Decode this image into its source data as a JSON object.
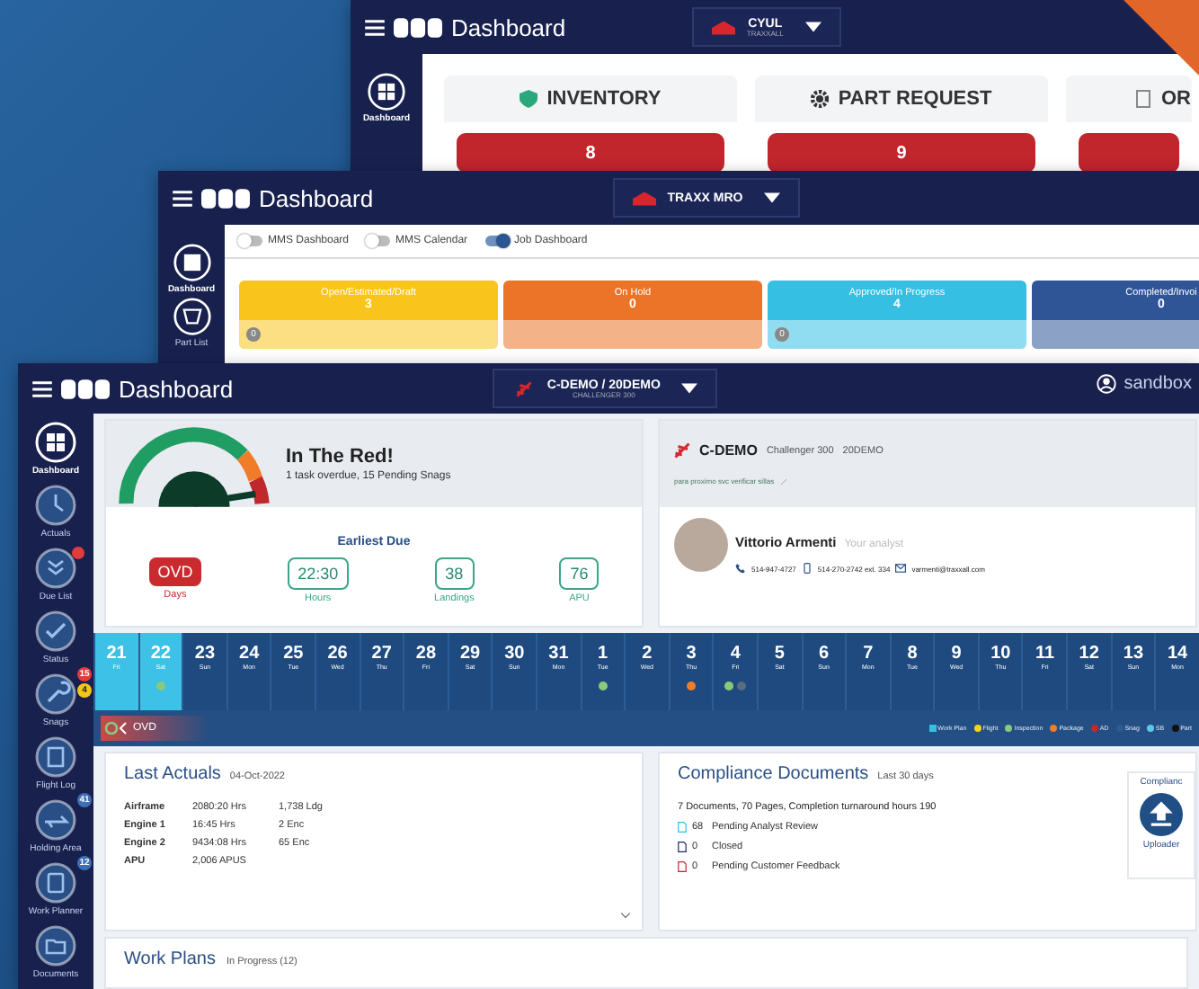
{
  "back_window": {
    "title": "Dashboard",
    "selector": {
      "name": "CYUL",
      "sub": "TRAXXALL"
    },
    "sidebar": [
      {
        "label": "Dashboard",
        "selected": true
      }
    ],
    "cards": [
      {
        "title": "INVENTORY",
        "value": "8"
      },
      {
        "title": "PART REQUEST",
        "value": "9"
      },
      {
        "title": "OR"
      }
    ]
  },
  "middle_window": {
    "title": "Dashboard",
    "selector": {
      "name": "TRAXX MRO"
    },
    "sidebar": [
      {
        "label": "Dashboard",
        "selected": true
      },
      {
        "label": "Part List",
        "selected": false
      }
    ],
    "toggles": [
      {
        "label": "MMS Dashboard",
        "on": false
      },
      {
        "label": "MMS Calendar",
        "on": false
      },
      {
        "label": "Job Dashboard",
        "on": true
      }
    ],
    "cards": [
      {
        "title": "Open/Estimated/Draft",
        "value": "3",
        "color": "#f9c51c",
        "badge": "0"
      },
      {
        "title": "On Hold",
        "value": "0",
        "color": "#ec7428"
      },
      {
        "title": "Approved/In Progress",
        "value": "4",
        "color": "#35bfe3",
        "badge": "0"
      },
      {
        "title": "Completed/Invoi",
        "value": "0",
        "color": "#2f5597"
      }
    ]
  },
  "front_window": {
    "title": "Dashboard",
    "selector": {
      "name": "C-DEMO / 20DEMO",
      "sub": "CHALLENGER 300"
    },
    "user": "sandbox",
    "sidebar": [
      {
        "label": "Dashboard",
        "selected": true
      },
      {
        "label": "Actuals",
        "selected": false
      },
      {
        "label": "Due List",
        "selected": false,
        "alert": true
      },
      {
        "label": "Status",
        "selected": false
      },
      {
        "label": "Snags",
        "selected": false,
        "badges": [
          "15",
          "4"
        ]
      },
      {
        "label": "Flight Log",
        "selected": false
      },
      {
        "label": "Holding Area",
        "selected": false,
        "badges": [
          "41"
        ]
      },
      {
        "label": "Work Planner",
        "selected": false,
        "badges": [
          "12"
        ]
      },
      {
        "label": "Documents",
        "selected": false
      }
    ],
    "status": {
      "title": "In The Red!",
      "subtitle": "1 task overdue, 15 Pending Snags",
      "due_title": "Earliest Due",
      "tiles": [
        {
          "value": "OVD",
          "label": "Days",
          "kind": "overdue"
        },
        {
          "value": "22:30",
          "label": "Hours",
          "kind": "ok"
        },
        {
          "value": "38",
          "label": "Landings",
          "kind": "ok"
        },
        {
          "value": "76",
          "label": "APU",
          "kind": "ok"
        }
      ]
    },
    "aircraft": {
      "registration": "C-DEMO",
      "model": "Challenger 300",
      "serial": "20DEMO",
      "note": "para proximo svc verificar sillas",
      "analyst": {
        "name": "Vittorio Armenti",
        "role": "Your analyst",
        "phone": "514-947-4727",
        "mobile": "514-270-2742 ext. 334",
        "email": "varmenti@traxxall.com"
      }
    },
    "calendar": {
      "days": [
        {
          "date": "21",
          "weekday": "Fri",
          "selected": true
        },
        {
          "date": "22",
          "weekday": "Sat",
          "selected": true,
          "dots": [
            {
              "color": "#8bc97a"
            }
          ]
        },
        {
          "date": "23",
          "weekday": "Sun",
          "selected": false
        },
        {
          "date": "24",
          "weekday": "Mon",
          "selected": false
        },
        {
          "date": "25",
          "weekday": "Tue",
          "selected": false
        },
        {
          "date": "26",
          "weekday": "Wed",
          "selected": false
        },
        {
          "date": "27",
          "weekday": "Thu",
          "selected": false
        },
        {
          "date": "28",
          "weekday": "Fri",
          "selected": false
        },
        {
          "date": "29",
          "weekday": "Sat",
          "selected": false
        },
        {
          "date": "30",
          "weekday": "Sun",
          "selected": false
        },
        {
          "date": "31",
          "weekday": "Mon",
          "selected": false
        },
        {
          "date": "1",
          "weekday": "Tue",
          "selected": false,
          "dots": [
            {
              "color": "#8bc97a"
            }
          ]
        },
        {
          "date": "2",
          "weekday": "Wed",
          "selected": false
        },
        {
          "date": "3",
          "weekday": "Thu",
          "selected": false,
          "dots": [
            {
              "color": "#f07b28"
            }
          ]
        },
        {
          "date": "4",
          "weekday": "Fri",
          "selected": false,
          "dots": [
            {
              "color": "#8bc97a"
            },
            {
              "color": "#5b6b80"
            }
          ]
        },
        {
          "date": "5",
          "weekday": "Sat",
          "selected": false
        },
        {
          "date": "6",
          "weekday": "Sun",
          "selected": false
        },
        {
          "date": "7",
          "weekday": "Mon",
          "selected": false
        },
        {
          "date": "8",
          "weekday": "Tue",
          "selected": false
        },
        {
          "date": "9",
          "weekday": "Wed",
          "selected": false
        },
        {
          "date": "10",
          "weekday": "Thu",
          "selected": false
        },
        {
          "date": "11",
          "weekday": "Fri",
          "selected": false
        },
        {
          "date": "12",
          "weekday": "Sat",
          "selected": false
        },
        {
          "date": "13",
          "weekday": "Sun",
          "selected": false
        },
        {
          "date": "14",
          "weekday": "Mon",
          "selected": false
        }
      ],
      "filter": "OVD",
      "legend": [
        {
          "label": "Work Plan",
          "color": "#35bfe3"
        },
        {
          "label": "Flight",
          "color": "#f5d31a"
        },
        {
          "label": "Inspection",
          "color": "#8bc97a"
        },
        {
          "label": "Package",
          "color": "#f07b28"
        },
        {
          "label": "AD",
          "color": "#c0282d"
        },
        {
          "label": "Snag",
          "color": "#2d5b8f"
        },
        {
          "label": "SB",
          "color": "#5bc8e8"
        },
        {
          "label": "Part",
          "color": "#111111"
        }
      ]
    },
    "last_actuals": {
      "title": "Last Actuals",
      "date": "04-Oct-2022",
      "rows": [
        {
          "name": "Airframe",
          "time": "2080:20 Hrs",
          "count": "1,738 Ldg"
        },
        {
          "name": "Engine 1",
          "time": "16:45 Hrs",
          "count": "2 Enc"
        },
        {
          "name": "Engine 2",
          "time": "9434:08 Hrs",
          "count": "65 Enc"
        },
        {
          "name": "APU",
          "time": "2,006 APUS"
        }
      ]
    },
    "compliance": {
      "title": "Compliance Documents",
      "period": "Last 30 days",
      "summary": "7 Documents, 70 Pages, Completion turnaround hours 190",
      "items": [
        {
          "count": "68",
          "label": "Pending Analyst Review",
          "color": "#35bfe3"
        },
        {
          "count": "0",
          "label": "Closed",
          "color": "#1b2a6b"
        },
        {
          "count": "0",
          "label": "Pending Customer Feedback",
          "color": "#c0282d"
        }
      ],
      "side_title": "Complianc",
      "uploader": "Uploader"
    },
    "work_plans": {
      "title": "Work Plans",
      "status": "In Progress (12)"
    }
  }
}
